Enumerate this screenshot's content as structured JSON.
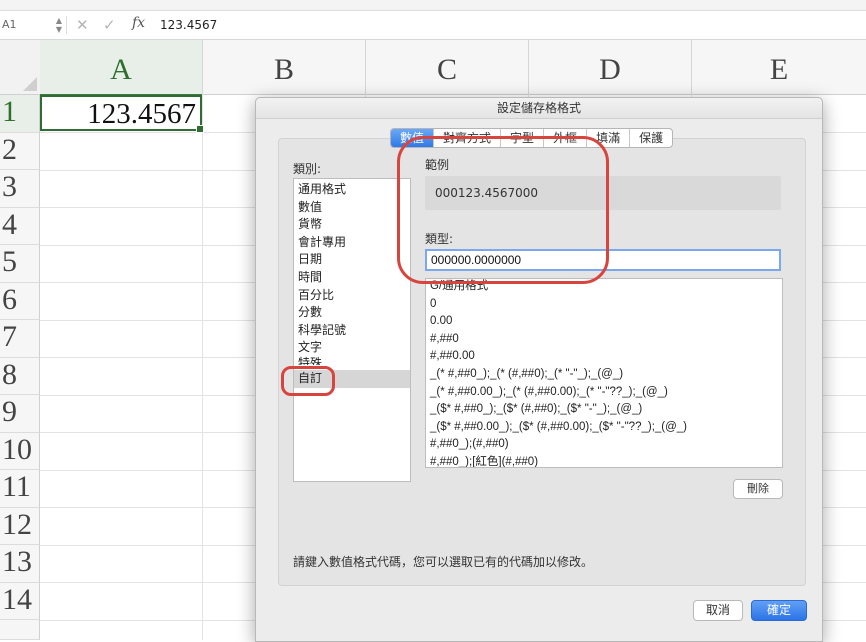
{
  "formula_bar": {
    "namebox": "A1",
    "cancel_glyph": "✕",
    "accept_glyph": "✓",
    "fx_label": "fx",
    "value": "123.4567"
  },
  "sheet": {
    "columns": [
      "A",
      "B",
      "C",
      "D",
      "E"
    ],
    "rows": [
      "1",
      "2",
      "3",
      "4",
      "5",
      "6",
      "7",
      "8",
      "9",
      "10",
      "11",
      "12",
      "13",
      "14"
    ],
    "selected_cell": {
      "column": "A",
      "row": "1",
      "display": "123.4567"
    }
  },
  "dialog": {
    "title": "設定儲存格格式",
    "tabs": [
      "數值",
      "對齊方式",
      "字型",
      "外框",
      "填滿",
      "保護"
    ],
    "active_tab": "數值",
    "category_label": "類別:",
    "categories": [
      "通用格式",
      "數值",
      "貨幣",
      "會計專用",
      "日期",
      "時間",
      "百分比",
      "分數",
      "科學記號",
      "文字",
      "特殊",
      "自訂"
    ],
    "selected_category": "自訂",
    "sample_label": "範例",
    "sample_value": "000123.4567000",
    "type_label": "類型:",
    "type_value": "000000.0000000",
    "format_list": [
      "G/通用格式",
      "0",
      "0.00",
      "#,##0",
      "#,##0.00",
      "_(* #,##0_);_(* (#,##0);_(* \"-\"_);_(@_)",
      "_(* #,##0.00_);_(* (#,##0.00);_(* \"-\"??_);_(@_)",
      "_($* #,##0_);_($* (#,##0);_($* \"-\"_);_(@_)",
      "_($* #,##0.00_);_($* (#,##0.00);_($* \"-\"??_);_(@_)",
      "#,##0_);(#,##0)",
      "#,##0_);[紅色](#,##0)"
    ],
    "delete_label": "刪除",
    "hint": "請鍵入數值格式代碼，您可以選取已有的代碼加以修改。",
    "cancel_label": "取消",
    "ok_label": "確定"
  },
  "colors": {
    "accent_blue": "#2f7ae8",
    "selection_green": "#2f6d34",
    "annotation_red": "#d8453f"
  }
}
